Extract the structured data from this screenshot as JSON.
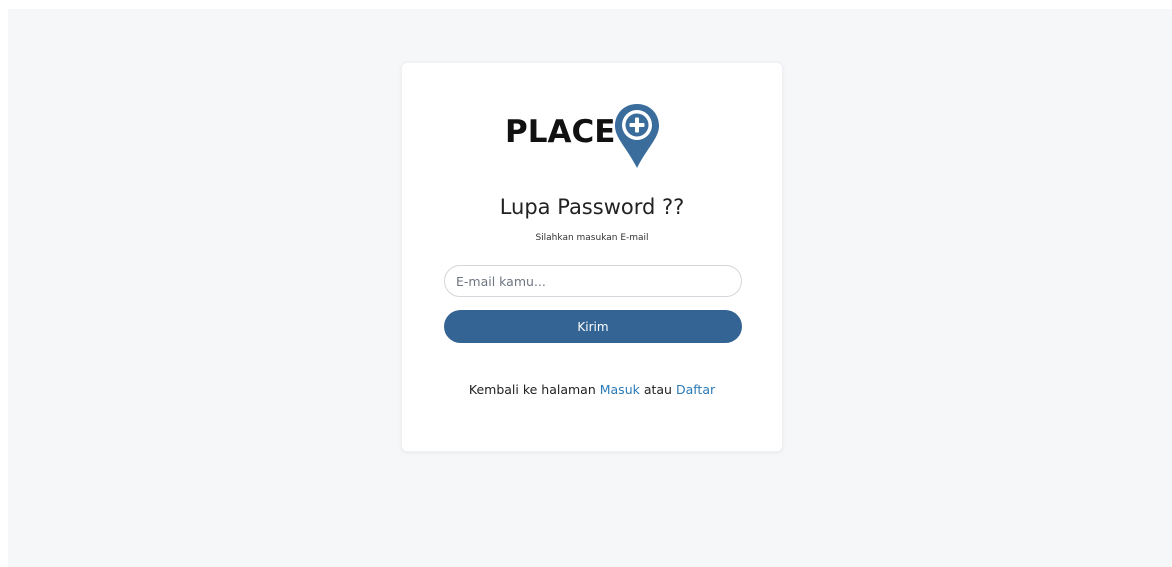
{
  "logo": {
    "text": "PLACE",
    "icon": "map-pin-plus-icon",
    "pin_color": "#3a6c9c"
  },
  "form": {
    "title": "Lupa Password ??",
    "subtitle": "Silahkan masukan E-mail",
    "email_placeholder": "E-mail kamu...",
    "email_value": "",
    "submit_label": "Kirim"
  },
  "footer": {
    "prefix": "Kembali ke halaman ",
    "login_link": "Masuk",
    "separator": " atau ",
    "register_link": "Daftar"
  },
  "colors": {
    "primary": "#346493",
    "link": "#2a7ab8",
    "background": "#f6f7f9"
  }
}
